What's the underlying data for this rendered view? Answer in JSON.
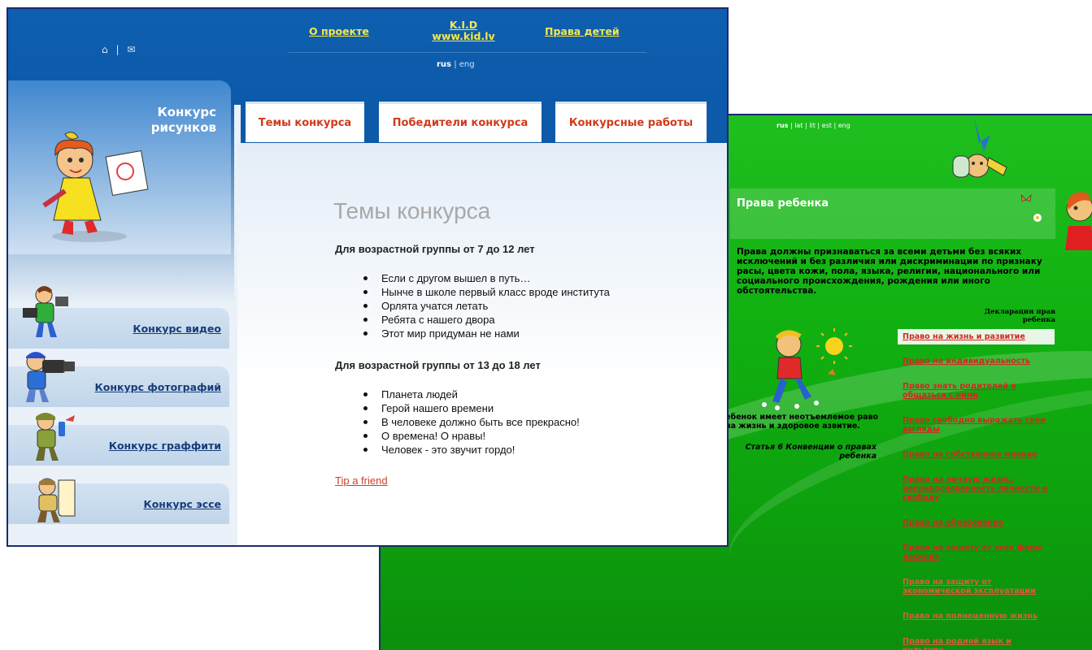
{
  "back_window": {
    "lang": {
      "current": "rus",
      "others": [
        "lat",
        "lit",
        "est",
        "eng"
      ]
    },
    "title": "Права ребенка",
    "intro": "Права должны признаваться за всеми детьми без всяких исключений и без различия или дискриминации по признаку расы, цвета кожи, пола, языка, религии, национального или социального происхождения, рождения или иного обстоятельства.",
    "declaration": "Декларация прав ребенка",
    "quote": "ебенок имеет неотъемлемое раво на жизнь и здоровое азвитие.",
    "quote_source": "Статья 6 Конвенции о правах ребенка",
    "rights": [
      "Право на жизнь и развитие",
      "Право на индивидуальность",
      "Право знать родителей и общаться с ними",
      "Право свободно выражать свои взгляды",
      "Право на собственное мнение",
      "Право на личную жизнь, неприкосновенность личности и свободу",
      "Право на образование",
      "Право на защиту от всех форм насилия",
      "Право на защиту от экономической эксплуатации",
      "Право на полноценную жизнь",
      "Право на родной язык и культуру"
    ]
  },
  "front_window": {
    "header_icons": [
      "home-icon",
      "mail-icon"
    ],
    "nav": {
      "about": "О проекте",
      "kid_line1": "K.I.D",
      "kid_line2": "www.kid.lv",
      "rights": "Права детей"
    },
    "lang": {
      "current": "rus",
      "separator": "|",
      "other": "eng"
    },
    "sidebar": {
      "hero_title_line1": "Конкурс",
      "hero_title_line2": "рисунков",
      "items": [
        "Конкурс видео",
        "Конкурс фотографий",
        "Конкурс граффити",
        "Конкурс эссе"
      ]
    },
    "tabs": [
      "Темы конкурса",
      "Победители конкурса",
      "Конкурсные работы"
    ],
    "main": {
      "heading": "Темы конкурса",
      "group1_title": "Для возрастной группы от 7 до 12 лет",
      "group1_items": [
        "Если с другом вышел в путь…",
        "Нынче в школе первый класс вроде института",
        "Орлята учатся летать",
        "Ребята с нашего двора",
        "Этот мир придуман не нами"
      ],
      "group2_title": "Для возрастной группы от 13 до 18 лет",
      "group2_items": [
        "Планета людей",
        "Герой нашего времени",
        "В человеке должно быть все прекрасно!",
        "О времена! О нравы!",
        "Человек - это звучит гордо!"
      ],
      "tip": "Tip a friend"
    }
  },
  "colors": {
    "blue_header": "#0c5aa9",
    "nav_link_yellow": "#f5e84a",
    "tab_text_red": "#d13a1a",
    "green_bg": "#11b011",
    "rights_link_red": "#d0291e"
  }
}
